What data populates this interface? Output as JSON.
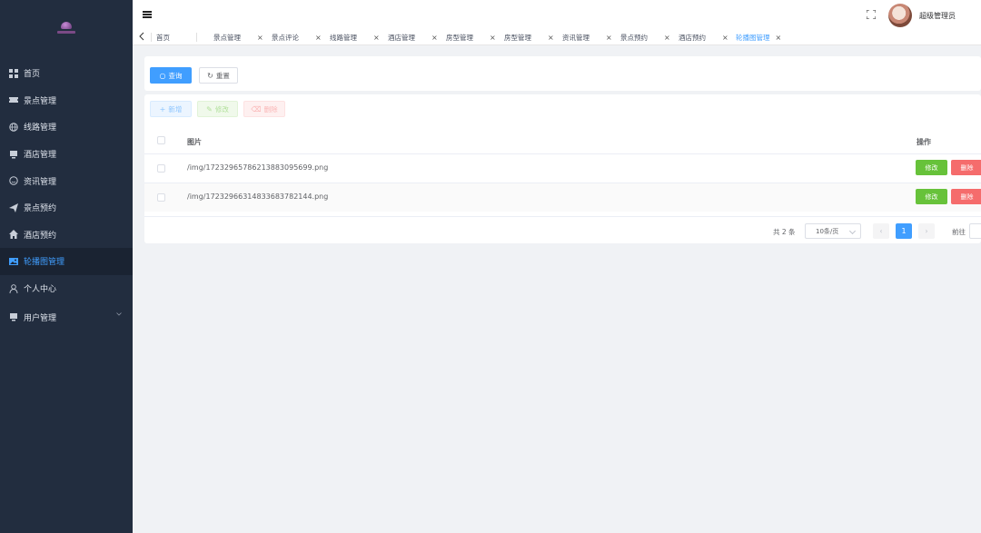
{
  "sidebar": {
    "items": [
      {
        "label": "首页",
        "icon": "grid-icon"
      },
      {
        "label": "景点管理",
        "icon": "ticket-icon"
      },
      {
        "label": "线路管理",
        "icon": "globe-icon"
      },
      {
        "label": "酒店管理",
        "icon": "monitor-icon"
      },
      {
        "label": "资讯管理",
        "icon": "smile-icon"
      },
      {
        "label": "景点预约",
        "icon": "send-icon"
      },
      {
        "label": "酒店预约",
        "icon": "home-icon"
      },
      {
        "label": "轮播图管理",
        "icon": "picture-icon"
      },
      {
        "label": "个人中心",
        "icon": "user-icon"
      },
      {
        "label": "用户管理",
        "icon": "monitor-icon"
      }
    ],
    "active_index": 7
  },
  "header": {
    "username": "超级管理员"
  },
  "tabs": [
    {
      "label": "首页"
    },
    {
      "label": "景点管理"
    },
    {
      "label": "景点评论"
    },
    {
      "label": "线路管理"
    },
    {
      "label": "酒店管理"
    },
    {
      "label": "房型管理"
    },
    {
      "label": "房型管理"
    },
    {
      "label": "资讯管理"
    },
    {
      "label": "景点预约"
    },
    {
      "label": "酒店预约"
    },
    {
      "label": "轮播图管理"
    }
  ],
  "search": {
    "query_label": "查询",
    "reset_label": "重置"
  },
  "toolbar": {
    "add_label": "新增",
    "edit_label": "修改",
    "delete_label": "删除"
  },
  "table": {
    "headers": {
      "image": "图片",
      "operation": "操作"
    },
    "rows": [
      {
        "path": "/img/17232965786213883095699.png"
      },
      {
        "path": "/img/17232966314833683782144.png"
      }
    ],
    "row_edit_label": "修改",
    "row_delete_label": "删除"
  },
  "pagination": {
    "total_text": "共 2 条",
    "page_size": "10条/页",
    "current_page": "1",
    "goto_label": "前往",
    "prev_symbol": "‹",
    "next_symbol": "›"
  },
  "colors": {
    "sidebar_bg": "#222d3f",
    "primary": "#409eff",
    "success": "#67c23a",
    "danger": "#f56c6c"
  }
}
